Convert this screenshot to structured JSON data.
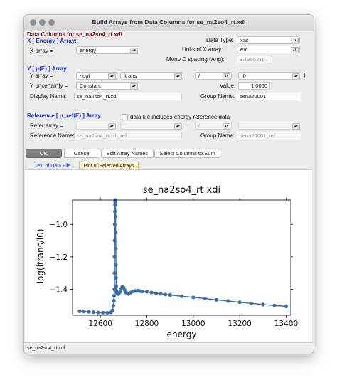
{
  "window": {
    "title": "Build Arrays from Data Columns for se_na2so4_rt.xdi"
  },
  "sections": {
    "data_columns": "Data Columns for se_na2so4_rt.xdi",
    "x_array": "X [ Energy ] Array:",
    "y_array": "Y [ μ(E) ] Array:",
    "ref_array": "Reference [ μ_ref(E) ] Array:"
  },
  "x": {
    "array_label": "X array =",
    "array_value": "energy",
    "data_type_label": "Data Type:",
    "data_type_value": "xas",
    "units_label": "Units of X array:",
    "units_value": "eV",
    "mono_label": "Mono D spacing (Ang):",
    "mono_value": "3.1355316"
  },
  "y": {
    "array_label": "Y array =",
    "op1": "-log(",
    "col1": "itrans",
    "op2": "/",
    "col2": "i0",
    "close_paren": ")",
    "uncert_label": "Y uncertainty =",
    "uncert_value": "Constant",
    "value_label": "Value:",
    "value_value": "1.0000",
    "display_label": "Display Name:",
    "display_value": "se_na2so4_rt.xdi",
    "group_label": "Group Name:",
    "group_value": "sena20001"
  },
  "ref": {
    "includes_label": "data file includes energy reference data",
    "array_label": "Refer array =",
    "op2": "/",
    "name_label": "Reference Name:",
    "name_value": "se_na2so4_rt.xdi_ref",
    "group_label": "Group Name:",
    "group_value": "sena20001_ref"
  },
  "buttons": {
    "ok": "OK",
    "cancel": "Cancel",
    "edit": "Edit Array Names",
    "select": "Select Columns to Sum"
  },
  "tabs": [
    {
      "label": "Text of Data File"
    },
    {
      "label": "Plot of Selected Arrays"
    }
  ],
  "status": {
    "text": "se_na2so4_rt.xdi"
  },
  "colors": {
    "series": "#3b6fa8",
    "section_blue": "#1d2fd1"
  },
  "chart_data": {
    "type": "scatter",
    "title": "se_na2so4_rt.xdi",
    "xlabel": "energy",
    "ylabel": "-log(itrans/i0)",
    "xlim": [
      12480,
      13420
    ],
    "ylim": [
      -1.56,
      -0.85
    ],
    "xticks": [
      12600,
      12800,
      13000,
      13200,
      13400
    ],
    "yticks": [
      -1.0,
      -1.2,
      -1.4
    ],
    "xtick_labels": [
      "12600",
      "12800",
      "13000",
      "13200",
      "13400"
    ],
    "ytick_labels": [
      "−1.0",
      "−1.2",
      "−1.4"
    ],
    "grid": false,
    "series": [
      {
        "x": [
          12510,
          12530,
          12550,
          12570,
          12590,
          12610,
          12630,
          12645,
          12652,
          12656,
          12658,
          12659,
          12660,
          12660.5,
          12661,
          12661.5,
          12662,
          12662.5,
          12663,
          12663.5,
          12664,
          12664.5,
          12665,
          12665.5,
          12666,
          12666.5,
          12667,
          12667.5,
          12668,
          12669,
          12670,
          12672,
          12675,
          12680,
          12685,
          12690,
          12695,
          12700,
          12705,
          12710,
          12720,
          12730,
          12740,
          12750,
          12760,
          12770,
          12780,
          12800,
          12820,
          12840,
          12860,
          12880,
          12900,
          12950,
          13000,
          13050,
          13100,
          13150,
          13200,
          13250,
          13300,
          13350,
          13400
        ],
        "y": [
          -1.535,
          -1.537,
          -1.539,
          -1.541,
          -1.543,
          -1.544,
          -1.545,
          -1.542,
          -1.53,
          -1.5,
          -1.47,
          -1.44,
          -1.4,
          -1.3,
          -1.2,
          -1.1,
          -1.0,
          -0.92,
          -0.88,
          -0.86,
          -0.85,
          -0.86,
          -0.88,
          -0.95,
          -1.05,
          -1.15,
          -1.25,
          -1.33,
          -1.38,
          -1.41,
          -1.42,
          -1.425,
          -1.43,
          -1.425,
          -1.415,
          -1.395,
          -1.385,
          -1.39,
          -1.405,
          -1.42,
          -1.428,
          -1.42,
          -1.413,
          -1.41,
          -1.408,
          -1.41,
          -1.413,
          -1.415,
          -1.42,
          -1.425,
          -1.428,
          -1.432,
          -1.435,
          -1.443,
          -1.45,
          -1.457,
          -1.465,
          -1.472,
          -1.48,
          -1.487,
          -1.494,
          -1.5,
          -1.505
        ]
      }
    ]
  }
}
